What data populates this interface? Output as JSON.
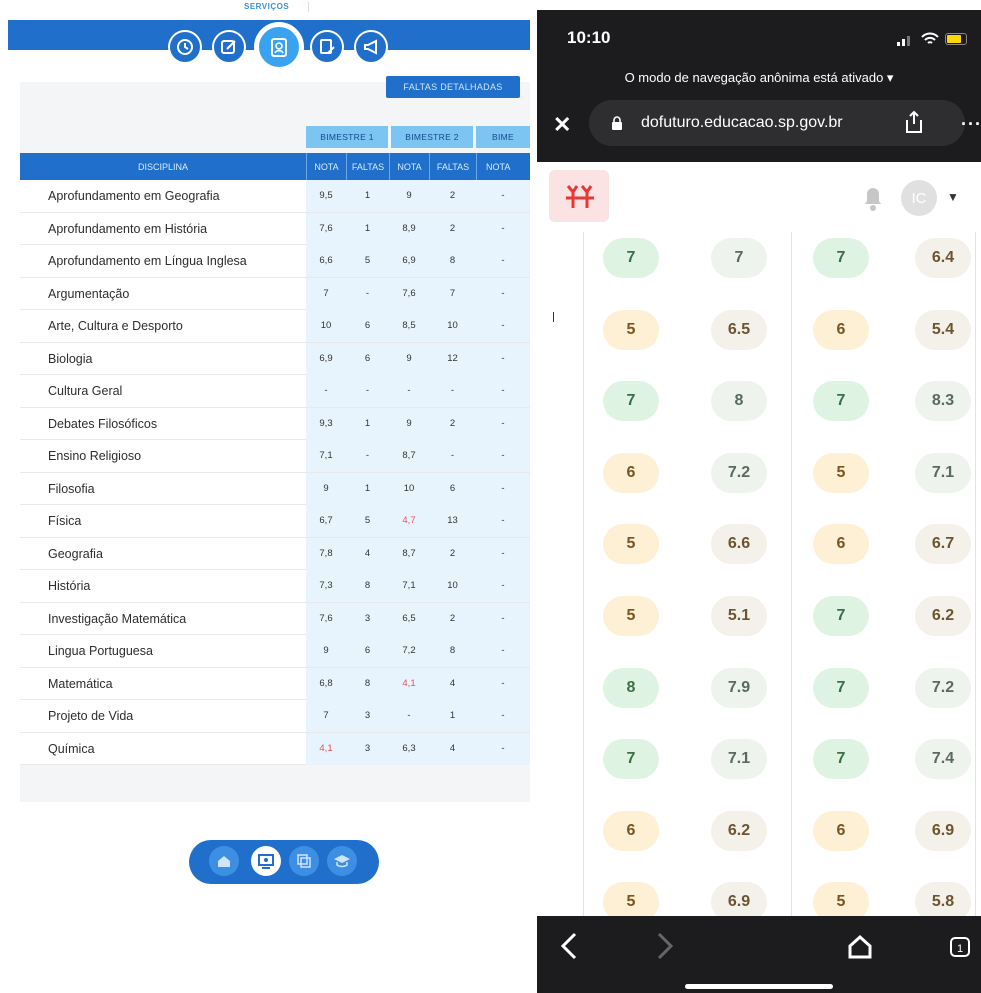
{
  "left": {
    "top_label": "SERVIÇOS",
    "faltas_button": "FALTAS DETALHADAS",
    "bimestres": [
      "BIMESTRE 1",
      "BIMESTRE 2",
      "BIME"
    ],
    "headers": {
      "disciplina": "DISCIPLINA",
      "nota": "NOTA",
      "faltas": "FALTAS"
    },
    "rows": [
      {
        "disciplina": "Aprofundamento em Geografia",
        "n1": "9,5",
        "f1": "1",
        "n2": "9",
        "f2": "2",
        "n3": "-"
      },
      {
        "disciplina": "Aprofundamento em História",
        "n1": "7,6",
        "f1": "1",
        "n2": "8,9",
        "f2": "2",
        "n3": "-"
      },
      {
        "disciplina": "Aprofundamento em Língua Inglesa",
        "n1": "6,6",
        "f1": "5",
        "n2": "6,9",
        "f2": "8",
        "n3": "-"
      },
      {
        "disciplina": "Argumentação",
        "n1": "7",
        "f1": "-",
        "n2": "7,6",
        "f2": "7",
        "n3": "-"
      },
      {
        "disciplina": "Arte, Cultura e Desporto",
        "n1": "10",
        "f1": "6",
        "n2": "8,5",
        "f2": "10",
        "n3": "-"
      },
      {
        "disciplina": "Biologia",
        "n1": "6,9",
        "f1": "6",
        "n2": "9",
        "f2": "12",
        "n3": "-"
      },
      {
        "disciplina": "Cultura Geral",
        "n1": "-",
        "f1": "-",
        "n2": "-",
        "f2": "-",
        "n3": "-"
      },
      {
        "disciplina": "Debates Filosóficos",
        "n1": "9,3",
        "f1": "1",
        "n2": "9",
        "f2": "2",
        "n3": "-"
      },
      {
        "disciplina": "Ensino Religioso",
        "n1": "7,1",
        "f1": "-",
        "n2": "8,7",
        "f2": "-",
        "n3": "-"
      },
      {
        "disciplina": "Filosofia",
        "n1": "9",
        "f1": "1",
        "n2": "10",
        "f2": "6",
        "n3": "-"
      },
      {
        "disciplina": "Física",
        "n1": "6,7",
        "f1": "5",
        "n2": "4,7",
        "f2": "13",
        "n3": "-"
      },
      {
        "disciplina": "Geografia",
        "n1": "7,8",
        "f1": "4",
        "n2": "8,7",
        "f2": "2",
        "n3": "-"
      },
      {
        "disciplina": "História",
        "n1": "7,3",
        "f1": "8",
        "n2": "7,1",
        "f2": "10",
        "n3": "-"
      },
      {
        "disciplina": "Investigação Matemática",
        "n1": "7,6",
        "f1": "3",
        "n2": "6,5",
        "f2": "2",
        "n3": "-"
      },
      {
        "disciplina": "Lingua Portuguesa",
        "n1": "9",
        "f1": "6",
        "n2": "7,2",
        "f2": "8",
        "n3": "-"
      },
      {
        "disciplina": "Matemática",
        "n1": "6,8",
        "f1": "8",
        "n2": "4,1",
        "f2": "4",
        "n3": "-"
      },
      {
        "disciplina": "Projeto de Vida",
        "n1": "7",
        "f1": "3",
        "n2": "-",
        "f2": "1",
        "n3": "-"
      },
      {
        "disciplina": "Química",
        "n1": "4,1",
        "f1": "3",
        "n2": "6,3",
        "f2": "4",
        "n3": "-"
      }
    ],
    "low_grade_color": "#e05555",
    "accent": "#1f6fcb"
  },
  "right": {
    "clock": "10:10",
    "incognito": "O modo de navegação anônima está ativado",
    "url": "dofuturo.educacao.sp.gov.br",
    "avatar_initials": "IC",
    "score_rows": [
      [
        [
          "7",
          "g"
        ],
        [
          "7",
          "n"
        ],
        [
          "7",
          "g"
        ],
        [
          "6.4",
          "t"
        ]
      ],
      [
        [
          "5",
          "y"
        ],
        [
          "6.5",
          "t"
        ],
        [
          "6",
          "y"
        ],
        [
          "5.4",
          "t"
        ]
      ],
      [
        [
          "7",
          "g"
        ],
        [
          "8",
          "n"
        ],
        [
          "7",
          "g"
        ],
        [
          "8.3",
          "n"
        ]
      ],
      [
        [
          "6",
          "y"
        ],
        [
          "7.2",
          "n"
        ],
        [
          "5",
          "y"
        ],
        [
          "7.1",
          "n"
        ]
      ],
      [
        [
          "5",
          "y"
        ],
        [
          "6.6",
          "t"
        ],
        [
          "6",
          "y"
        ],
        [
          "6.7",
          "t"
        ]
      ],
      [
        [
          "5",
          "y"
        ],
        [
          "5.1",
          "t"
        ],
        [
          "7",
          "g"
        ],
        [
          "6.2",
          "t"
        ]
      ],
      [
        [
          "8",
          "g"
        ],
        [
          "7.9",
          "n"
        ],
        [
          "7",
          "g"
        ],
        [
          "7.2",
          "n"
        ]
      ],
      [
        [
          "7",
          "g"
        ],
        [
          "7.1",
          "n"
        ],
        [
          "7",
          "g"
        ],
        [
          "7.4",
          "n"
        ]
      ],
      [
        [
          "6",
          "y"
        ],
        [
          "6.2",
          "t"
        ],
        [
          "6",
          "y"
        ],
        [
          "6.9",
          "t"
        ]
      ],
      [
        [
          "5",
          "y"
        ],
        [
          "6.9",
          "t"
        ],
        [
          "5",
          "y"
        ],
        [
          "5.8",
          "t"
        ]
      ]
    ]
  }
}
